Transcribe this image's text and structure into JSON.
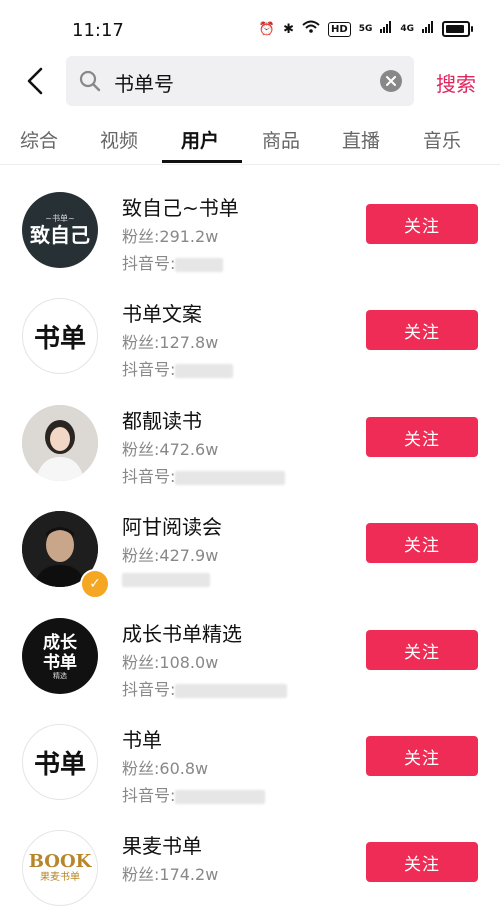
{
  "status_bar": {
    "time": "11:17",
    "hd": "HD",
    "sig1": "5G",
    "sig2": "4G"
  },
  "search": {
    "value": "书单号",
    "button": "搜索"
  },
  "tabs": [
    {
      "label": "综合"
    },
    {
      "label": "视频"
    },
    {
      "label": "用户"
    },
    {
      "label": "商品"
    },
    {
      "label": "直播"
    },
    {
      "label": "音乐"
    }
  ],
  "active_tab": "用户",
  "accent_color": "#ee2c55",
  "users": [
    {
      "name": "致自己~书单",
      "fans": "粉丝:291.2w",
      "douyin_label": "抖音号:",
      "avatar_text": "致自己",
      "avatar_small": "~书单~",
      "follow": "关注"
    },
    {
      "name": "书单文案",
      "fans": "粉丝:127.8w",
      "douyin_label": "抖音号:",
      "avatar_text": "书单",
      "follow": "关注"
    },
    {
      "name": "都靓读书",
      "fans": "粉丝:472.6w",
      "douyin_label": "抖音号:",
      "follow": "关注"
    },
    {
      "name": "阿甘阅读会",
      "fans": "粉丝:427.9w",
      "follow": "关注"
    },
    {
      "name": "成长书单精选",
      "fans": "粉丝:108.0w",
      "douyin_label": "抖音号:",
      "avatar_text": "成长书单",
      "avatar_small": "精选",
      "follow": "关注"
    },
    {
      "name": "书单",
      "fans": "粉丝:60.8w",
      "douyin_label": "抖音号:",
      "avatar_text": "书单",
      "follow": "关注"
    },
    {
      "name": "果麦书单",
      "fans": "粉丝:174.2w",
      "avatar_text": "BOOK",
      "avatar_small": "果麦书单",
      "follow": "关注"
    }
  ]
}
